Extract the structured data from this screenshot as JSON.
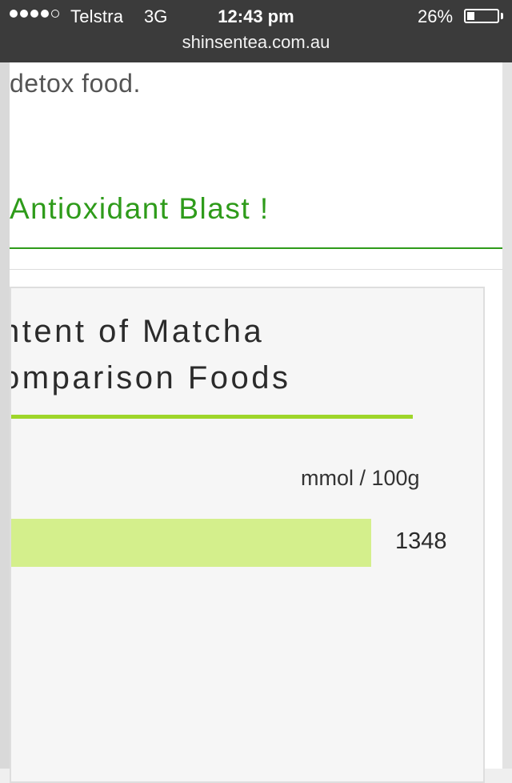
{
  "status_bar": {
    "carrier": "Telstra",
    "network": "3G",
    "time": "12:43 pm",
    "battery_percent": "26%",
    "battery_level": 0.26,
    "signal_bars_filled": 4,
    "signal_bars_total": 5,
    "url": "shinsentea.com.au"
  },
  "article": {
    "body_text": "detox food.",
    "section_heading": "Antioxidant Blast !"
  },
  "infographic": {
    "title_line_1": "ntent of Matcha",
    "title_line_2": "omparison Foods",
    "accent_color": "#9ed62a",
    "bar_color": "#d4ef8c"
  },
  "chart_data": {
    "type": "bar",
    "orientation": "horizontal",
    "title": "ntent of Matcha omparison Foods",
    "unit_label": "mmol / 100g",
    "categories": [
      ""
    ],
    "values": [
      1348
    ],
    "value_labels": [
      "1348"
    ]
  },
  "colors": {
    "heading_green": "#2e9b1a",
    "status_bar_bg": "#3b3b3b"
  }
}
